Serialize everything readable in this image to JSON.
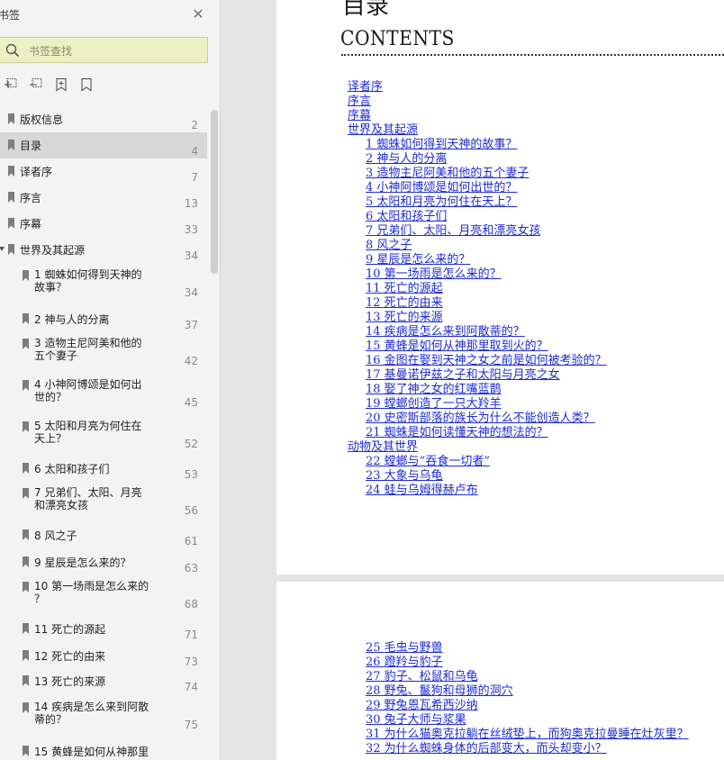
{
  "sidebar": {
    "title": "书签",
    "search_placeholder": "书签查找",
    "bookmarks": [
      {
        "label": "版权信息",
        "page": "2"
      },
      {
        "label": "目录",
        "page": "4"
      },
      {
        "label": "译者序",
        "page": "7"
      },
      {
        "label": "序言",
        "page": "13"
      },
      {
        "label": "序幕",
        "page": "33"
      },
      {
        "label": "世界及其起源",
        "page": "34"
      },
      {
        "label": "1 蜘蛛如何得到天神的故事？",
        "line1": "1 蜘蛛如何得到天神的",
        "line2": "故事？",
        "page": "34"
      },
      {
        "label": "2 神与人的分离",
        "page": "37"
      },
      {
        "label": "3 造物主尼阿美和他的五个妻子",
        "line1": "3 造物主尼阿美和他的",
        "line2": "五个妻子",
        "page": "42"
      },
      {
        "label": "4 小神阿博颂是如何出世的？",
        "line1": "4 小神阿博颂是如何出",
        "line2": "世的？",
        "page": "45"
      },
      {
        "label": "5 太阳和月亮为何住在天上？",
        "line1": "5 太阳和月亮为何住在",
        "line2": "天上？",
        "page": "52"
      },
      {
        "label": "6 太阳和孩子们",
        "page": "53"
      },
      {
        "label": "7 兄弟们、太阳、月亮和漂亮女孩",
        "line1": "7 兄弟们、太阳、月亮",
        "line2": "和漂亮女孩",
        "page": "56"
      },
      {
        "label": "8 风之子",
        "page": "61"
      },
      {
        "label": "9 星辰是怎么来的？",
        "page": "63"
      },
      {
        "label": "10 第一场雨是怎么来的？",
        "line1": "10 第一场雨是怎么来的",
        "line2": "？",
        "page": "68"
      },
      {
        "label": "11 死亡的源起",
        "page": "71"
      },
      {
        "label": "12 死亡的由来",
        "page": "73"
      },
      {
        "label": "13 死亡的来源",
        "page": "74"
      },
      {
        "label": "14 疾病是怎么来到阿散蒂的？",
        "line1": "14 疾病是怎么来到阿散",
        "line2": "蒂的？",
        "page": "75"
      },
      {
        "label": "15 黄蜂是如何从神那里",
        "line1": "15 黄蜂是如何从神那里",
        "line2": "",
        "page": ""
      }
    ]
  },
  "document": {
    "heading_cn": "目录",
    "heading_en": "CONTENTS",
    "page1_entries": [
      "译者序",
      "序言",
      "序幕",
      "世界及其起源",
      "1 蜘蛛如何得到天神的故事？",
      "2 神与人的分离",
      "3 造物主尼阿美和他的五个妻子",
      "4 小神阿博颂是如何出世的？",
      "5 太阳和月亮为何住在天上？",
      "6 太阳和孩子们",
      "7 兄弟们、太阳、月亮和漂亮女孩",
      "8 风之子",
      "9 星辰是怎么来的？",
      "10 第一场雨是怎么来的？",
      "11 死亡的源起",
      "12 死亡的由来",
      "13 死亡的来源",
      "14 疾病是怎么来到阿散蒂的？",
      "15 黄蜂是如何从神那里取到火的？",
      "16 金图在娶到天神之女之前是如何被考验的？",
      "17 基曼诺伊兹之子和太阳与月亮之女",
      "18 娶了神之女的红嘴蓝鹊",
      "19 螳螂创造了一只大羚羊",
      "20 史密斯部落的族长为什么不能创造人类？",
      "21 蜘蛛是如何读懂天神的想法的？",
      "动物及其世界",
      "22 螳螂与“吞食一切者”",
      "23 大象与乌龟",
      "24 蛙与乌姆得赫卢布"
    ],
    "page2_entries": [
      "25 毛虫与野兽",
      "26 蹬羚与豹子",
      "27 豹子、松鼠和乌龟",
      "28 野兔、鬣狗和母狮的洞穴",
      "29 野兔恩瓦希西沙纳",
      "30 兔子大师与浆果",
      "31 为什么猫奥克拉躺在丝绒垫上，而狗奥克拉曼睡在灶灰里？",
      "32 为什么蜘蛛身体的后部变大，而头却变小？"
    ]
  },
  "colors": {
    "link": "#1d2bd6",
    "search_bg": "#ebf0c5",
    "selected_bg": "#d8d8d8"
  }
}
